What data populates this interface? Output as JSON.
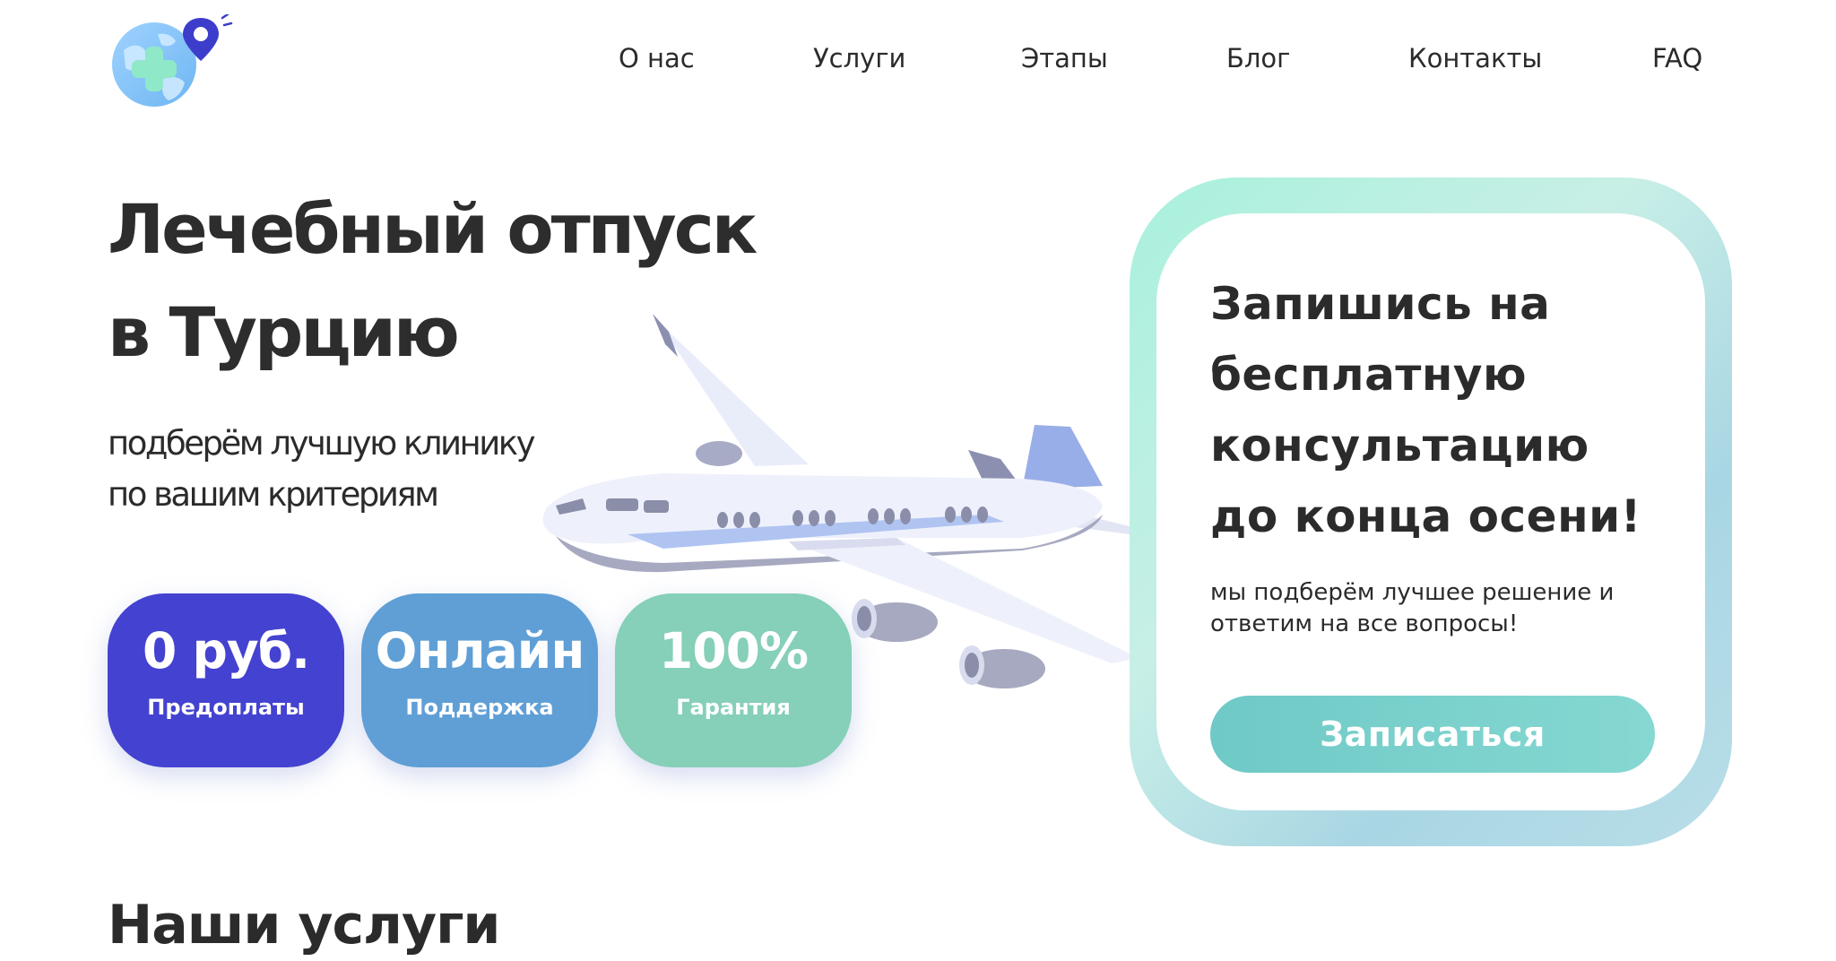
{
  "nav": {
    "items": [
      "О нас",
      "Услуги",
      "Этапы",
      "Блог",
      "Контакты",
      "FAQ"
    ]
  },
  "hero": {
    "title_lines": [
      "Лечебный отпуск",
      "в Турцию"
    ],
    "subtitle_lines": [
      "подберём лучшую клинику",
      "по вашим критериям"
    ]
  },
  "stats": [
    {
      "value": "0 руб.",
      "label": "Предоплаты",
      "color": "#4442d0"
    },
    {
      "value": "Онлайн",
      "label": "Поддержка",
      "color": "#5f9fd6"
    },
    {
      "value": "100%",
      "label": "Гарантия",
      "color": "#86cfb9"
    }
  ],
  "cta_card": {
    "title_lines": [
      "Запишись на",
      "бесплатную",
      "консультацию",
      "до конца осени!"
    ],
    "text_lines": [
      "мы подберём лучшее решение и",
      "ответим на все вопросы!"
    ],
    "button_label": "Записаться",
    "button_color_start": "#6fc9c6",
    "button_color_end": "#86d8d2"
  },
  "services": {
    "title": "Наши услуги"
  },
  "icons": {
    "logo": "globe-location-pin-icon"
  }
}
